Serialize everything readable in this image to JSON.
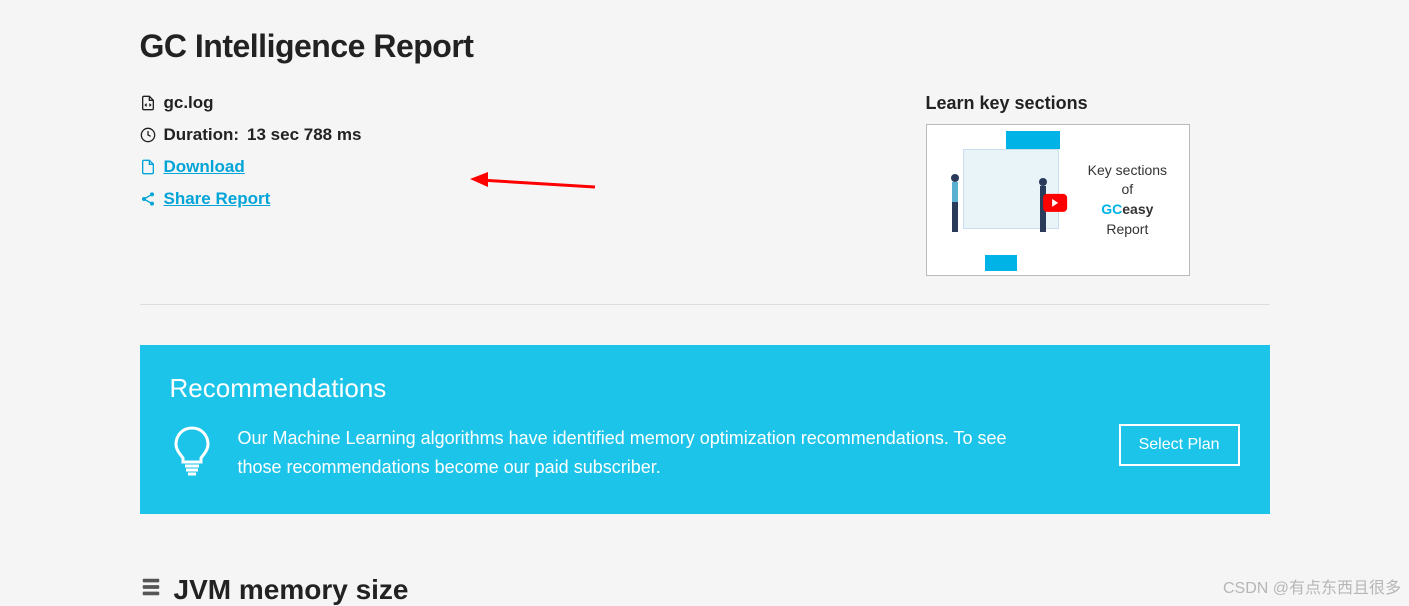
{
  "page_title": "GC Intelligence Report",
  "info": {
    "file_name": "gc.log",
    "duration_label": "Duration:",
    "duration_value": "13 sec 788 ms",
    "download_label": "Download",
    "share_label": "Share Report"
  },
  "learn": {
    "title": "Learn key sections",
    "thumb_line1": "Key sections",
    "thumb_line2": "of",
    "thumb_gc": "GC",
    "thumb_easy": "easy",
    "thumb_line4": "Report"
  },
  "recommendations": {
    "title": "Recommendations",
    "text": "Our Machine Learning algorithms have identified memory optimization recommendations. To see those recommendations become our paid subscriber.",
    "button": "Select Plan"
  },
  "jvm": {
    "title": "JVM memory size"
  },
  "watermark": "CSDN @有点东西且很多"
}
